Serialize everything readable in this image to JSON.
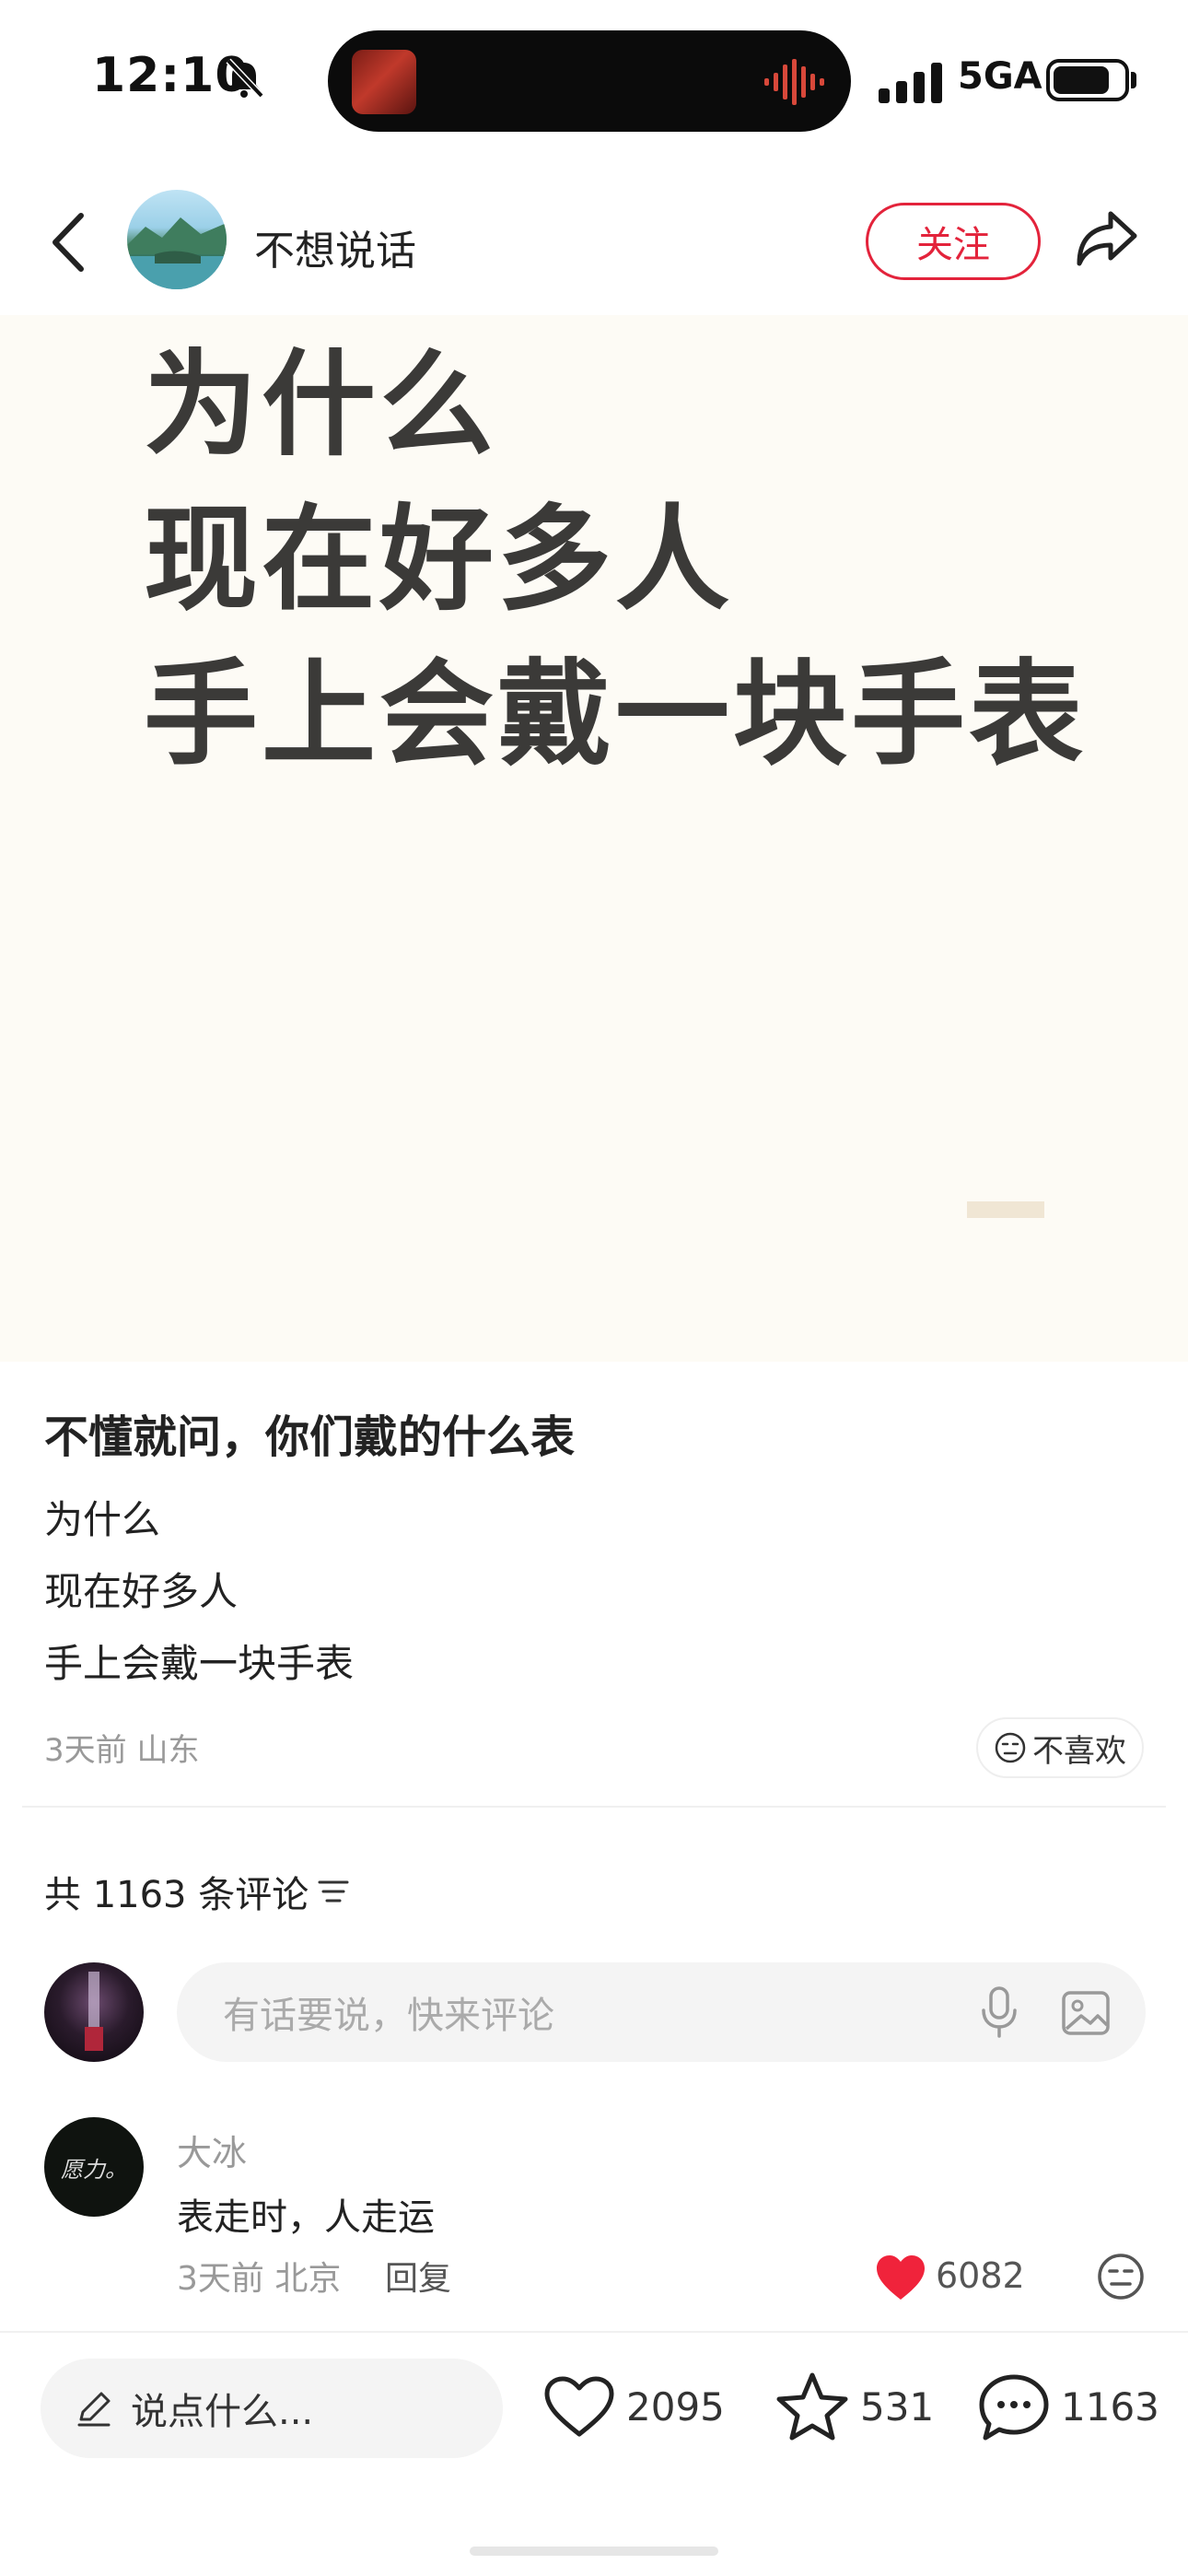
{
  "status_bar": {
    "time": "12:10",
    "network": "5GA"
  },
  "header": {
    "author_name": "不想说话",
    "follow_label": "关注"
  },
  "cover": {
    "lines": [
      "为什么",
      "现在好多人",
      "手上会戴一块手表"
    ]
  },
  "note": {
    "title": "不懂就问，你们戴的什么表",
    "body": [
      "为什么",
      "现在好多人",
      "手上会戴一块手表"
    ],
    "meta": "3天前 山东",
    "dislike_label": "不喜欢"
  },
  "comments": {
    "count_label": "共 1163 条评论",
    "input_placeholder": "有话要说，快来评论",
    "items": [
      {
        "user": "大冰",
        "avatar_text": "愿力。",
        "text": "表走时，人走运",
        "meta": "3天前 北京",
        "reply_label": "回复",
        "likes": "6082"
      }
    ]
  },
  "bottom_bar": {
    "say_placeholder": "说点什么...",
    "like_count": "2095",
    "star_count": "531",
    "comment_count": "1163"
  },
  "colors": {
    "accent": "#e3233b",
    "cover_bg": "#fdfbf5",
    "cover_text": "#3b3a38"
  }
}
